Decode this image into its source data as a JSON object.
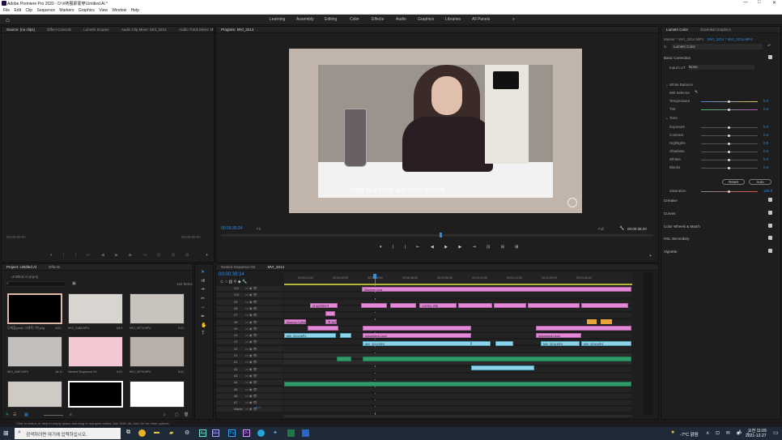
{
  "window": {
    "title": "Adobe Premiere Pro 2020 - D:\\#熱展即寰穿\\Untitled.Al *",
    "controls": [
      "—",
      "□",
      "✕"
    ]
  },
  "menu": [
    "File",
    "Edit",
    "Clip",
    "Sequence",
    "Markers",
    "Graphics",
    "View",
    "Window",
    "Help"
  ],
  "workspaces": [
    "Learning",
    "Assembly",
    "Editing",
    "Color",
    "Effects",
    "Audio",
    "Graphics",
    "Libraries",
    "All Panels"
  ],
  "source_panel": {
    "tabs": [
      "Source: (no clips)",
      "Effect Controls",
      "Lumetri Scopes",
      "Audio Clip Mixer: MVI_3214",
      "Audio Track Mixer: MV"
    ],
    "timecode_left": "00:00:00:00",
    "timecode_right": "00:00:00:00"
  },
  "program_panel": {
    "tab": "Program: MVI_3214",
    "timecode": "00:00:39:24",
    "fit": "Fit",
    "fit_right": "Full",
    "duration": "00:00:35:20",
    "subtitle": "사계절 내내 커피를 즐겨 마시는 편이지만"
  },
  "project_panel": {
    "tabs": [
      "Project: Untitled.Al",
      "Effects"
    ],
    "file": "Untitled.Al.prproj",
    "item_count": "134 Items",
    "items": [
      {
        "label": "무제집(psd)□그래픽.□백.png",
        "dur": "4:00"
      },
      {
        "label": "MVI_3188.MP4",
        "dur": "54:3"
      },
      {
        "label": "MVI_3071.MP4",
        "dur": "9:21"
      },
      {
        "label": "MVI_3087.MP4",
        "dur": "16:11"
      },
      {
        "label": "Nested Sequence 03",
        "dur": "3:01"
      },
      {
        "label": "MVI_3079.MP4",
        "dur": "8:02"
      }
    ]
  },
  "timeline": {
    "tabs": [
      "Nested Sequence 03",
      "MVI_3214"
    ],
    "timecode": "00:00:39:24",
    "ruler": [
      "00:00:24:00",
      "00:00:32:00",
      "00:00:40:00",
      "00:00:48:00",
      "00:00:56:00",
      "00:01:04:00",
      "00:01:12:00",
      "00:01:20:00",
      "00:01:28:00"
    ],
    "tracks": [
      "V11",
      "V10",
      "V9",
      "V8",
      "V7",
      "V6",
      "V5",
      "V4",
      "V3",
      "V2",
      "V1",
      "A1",
      "A2",
      "A3",
      "A4",
      "A5",
      "A6",
      "A7",
      "Master"
    ],
    "master_value": "0.0",
    "clips_text": [
      "Shipping Long",
      "내 트리메이션",
      "백 트리니",
      "스타벅스 커피",
      "Morning Coffee",
      "Adjustment Layer",
      "MVI_3214.MP4",
      "MVI_3216.MP4"
    ]
  },
  "lumetri": {
    "tabs": [
      "Lumetri Color",
      "Essential Graphics"
    ],
    "master": "Master * MVI_3214.MP4",
    "target": "MVI_3214 * MVI_3214.MP4",
    "preset": "Lumetri Color",
    "sections": [
      "Basic Correction",
      "Creative",
      "Curves",
      "Color Wheels & Match",
      "HSL Secondary",
      "Vignette"
    ],
    "input_lut": "None",
    "rows": [
      {
        "name": "Temperature",
        "value": "0.0"
      },
      {
        "name": "Tint",
        "value": "0.0"
      },
      {
        "name": "Exposure",
        "value": "0.0"
      },
      {
        "name": "Contrast",
        "value": "0.0"
      },
      {
        "name": "Highlights",
        "value": "0.0"
      },
      {
        "name": "Shadows",
        "value": "0.0"
      },
      {
        "name": "Whites",
        "value": "0.0"
      },
      {
        "name": "Blacks",
        "value": "0.0"
      },
      {
        "name": "Saturation",
        "value": "100.0"
      }
    ],
    "reset": "Reset",
    "auto": "Auto"
  },
  "status": "Click to select, or click in empty space and drag to marquee select. Use Shift, Alt, and Ctrl for other options.",
  "taskbar": {
    "search_placeholder": "검색하려면 여기에 입력하십시오.",
    "weather": "-7°C 맑음",
    "time": "오전 11:09",
    "date": "2021-12-27",
    "lang": "A"
  }
}
